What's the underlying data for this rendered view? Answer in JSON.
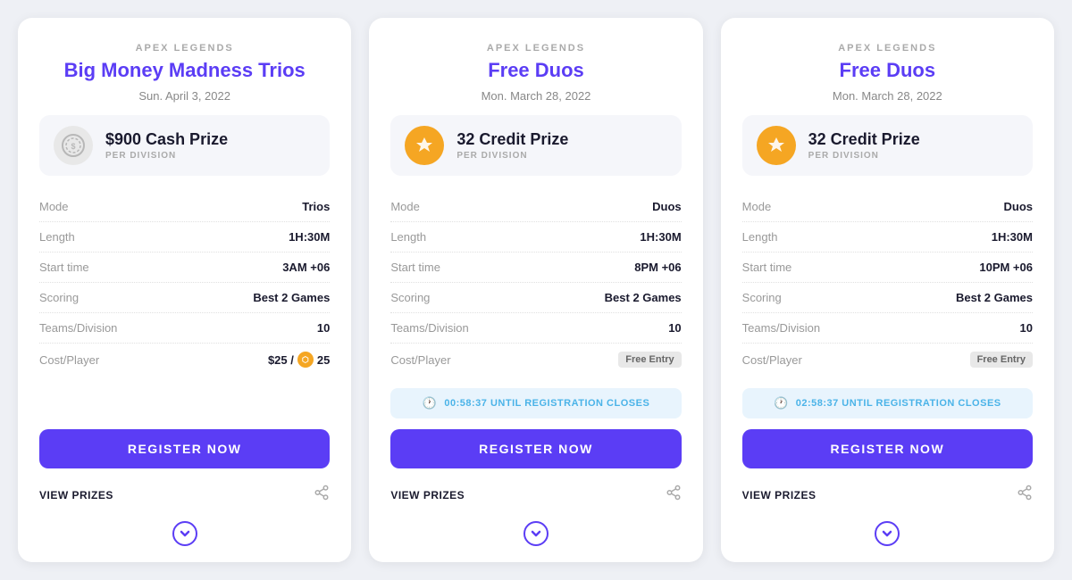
{
  "cards": [
    {
      "id": "card-1",
      "game": "APEX LEGENDS",
      "title": "Big Money Madness Trios",
      "date": "Sun. April 3, 2022",
      "prize": {
        "type": "cash",
        "amount": "$900 Cash Prize",
        "label": "PER DIVISION"
      },
      "stats": [
        {
          "label": "Mode",
          "value": "Trios",
          "type": "normal"
        },
        {
          "label": "Length",
          "value": "1H:30M",
          "type": "normal"
        },
        {
          "label": "Start time",
          "value": "3AM +06",
          "type": "normal"
        },
        {
          "label": "Scoring",
          "value": "Best 2 Games",
          "type": "bold"
        },
        {
          "label": "Teams/Division",
          "value": "10",
          "type": "normal"
        },
        {
          "label": "Cost/Player",
          "value": "$25 / 25",
          "type": "cost"
        }
      ],
      "timer": null,
      "registerLabel": "REGISTER NOW",
      "viewPrizesLabel": "VIEW PRIZES",
      "showChevron": true
    },
    {
      "id": "card-2",
      "game": "APEX LEGENDS",
      "title": "Free Duos",
      "date": "Mon. March 28, 2022",
      "prize": {
        "type": "credit",
        "amount": "32 Credit Prize",
        "label": "PER DIVISION"
      },
      "stats": [
        {
          "label": "Mode",
          "value": "Duos",
          "type": "normal"
        },
        {
          "label": "Length",
          "value": "1H:30M",
          "type": "normal"
        },
        {
          "label": "Start time",
          "value": "8PM +06",
          "type": "normal"
        },
        {
          "label": "Scoring",
          "value": "Best 2 Games",
          "type": "bold"
        },
        {
          "label": "Teams/Division",
          "value": "10",
          "type": "normal"
        },
        {
          "label": "Cost/Player",
          "value": "Free Entry",
          "type": "free"
        }
      ],
      "timer": "00:58:37 UNTIL REGISTRATION CLOSES",
      "registerLabel": "REGISTER NOW",
      "viewPrizesLabel": "VIEW PRIZES",
      "showChevron": true
    },
    {
      "id": "card-3",
      "game": "APEX LEGENDS",
      "title": "Free Duos",
      "date": "Mon. March 28, 2022",
      "prize": {
        "type": "credit",
        "amount": "32 Credit Prize",
        "label": "PER DIVISION"
      },
      "stats": [
        {
          "label": "Mode",
          "value": "Duos",
          "type": "normal"
        },
        {
          "label": "Length",
          "value": "1H:30M",
          "type": "normal"
        },
        {
          "label": "Start time",
          "value": "10PM +06",
          "type": "normal"
        },
        {
          "label": "Scoring",
          "value": "Best 2 Games",
          "type": "bold"
        },
        {
          "label": "Teams/Division",
          "value": "10",
          "type": "normal"
        },
        {
          "label": "Cost/Player",
          "value": "Free Entry",
          "type": "free"
        }
      ],
      "timer": "02:58:37 UNTIL REGISTRATION CLOSES",
      "registerLabel": "REGISTER NOW",
      "viewPrizesLabel": "VIEW PRIZES",
      "showChevron": true
    }
  ]
}
